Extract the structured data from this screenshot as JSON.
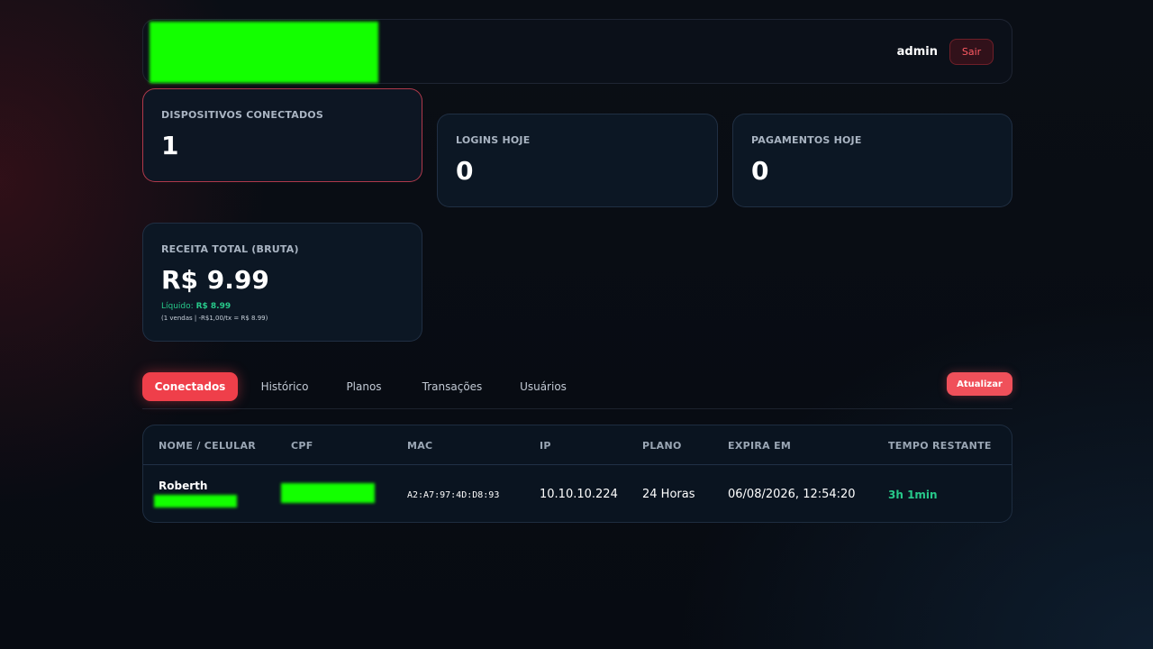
{
  "header": {
    "user": "admin",
    "logout_label": "Sair"
  },
  "stats": {
    "devices": {
      "label": "DISPOSITIVOS CONECTADOS",
      "value": "1"
    },
    "logins": {
      "label": "LOGINS HOJE",
      "value": "0"
    },
    "payments": {
      "label": "PAGAMENTOS HOJE",
      "value": "0"
    },
    "revenue": {
      "label": "RECEITA TOTAL (BRUTA)",
      "value": "R$ 9.99",
      "net_prefix": "Líquido:",
      "net_value": "R$ 8.99",
      "detail": "(1 vendas | -R$1,00/tx = R$ 8.99)"
    }
  },
  "tabs": [
    {
      "label": "Conectados",
      "active": true
    },
    {
      "label": "Histórico",
      "active": false
    },
    {
      "label": "Planos",
      "active": false
    },
    {
      "label": "Transações",
      "active": false
    },
    {
      "label": "Usuários",
      "active": false
    }
  ],
  "refresh_label": "Atualizar",
  "table": {
    "columns": [
      "NOME / CELULAR",
      "CPF",
      "MAC",
      "IP",
      "PLANO",
      "EXPIRA EM",
      "TEMPO RESTANTE"
    ],
    "rows": [
      {
        "name": "Roberth",
        "mac": "A2:A7:97:4D:D8:93",
        "ip": "10.10.10.224",
        "plan": "24 Horas",
        "expires": "06/08/2026, 12:54:20",
        "remaining": "3h 1min"
      }
    ]
  },
  "colors": {
    "accent": "#ef3f4a",
    "success": "#27c98a",
    "redaction": "#13ff00"
  }
}
